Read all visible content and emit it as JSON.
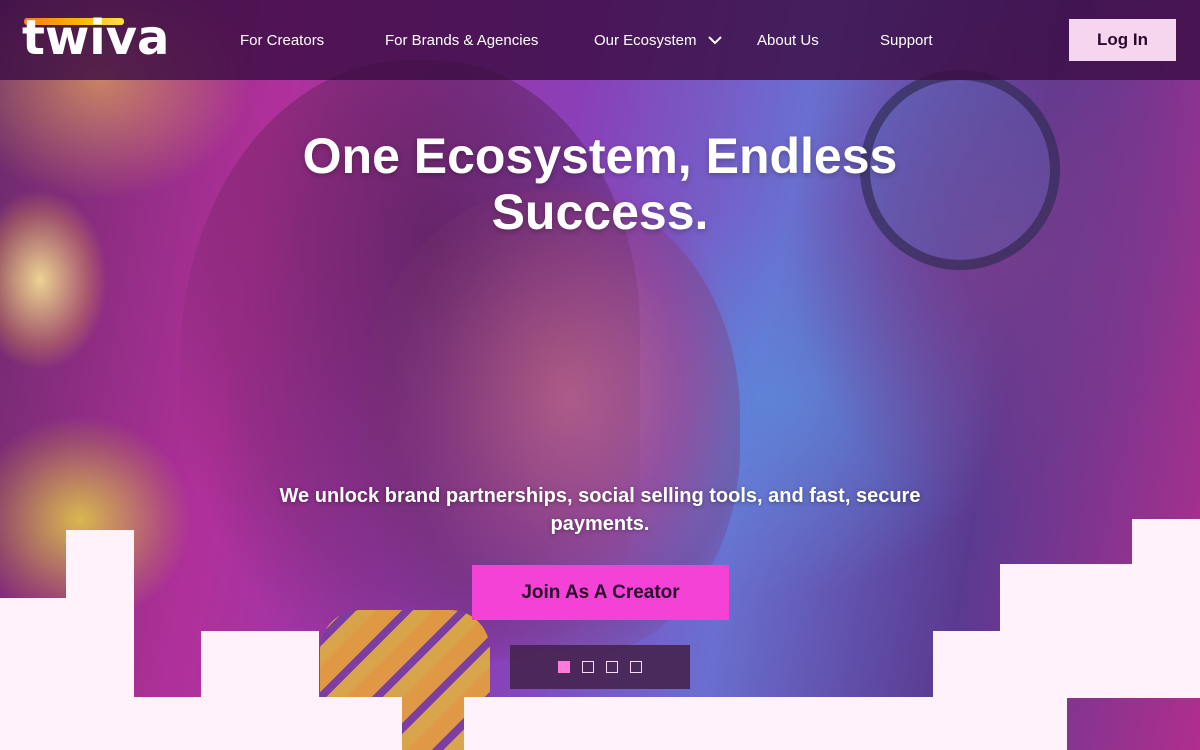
{
  "brand": {
    "name": "twiva",
    "bar_gradient": [
      "#ff7a1a",
      "#ffb400",
      "#ffe14a"
    ]
  },
  "nav": {
    "items": [
      {
        "label": "For Creators"
      },
      {
        "label": "For Brands & Agencies"
      },
      {
        "label": "Our Ecosystem",
        "has_dropdown": true,
        "icon": "chevron-down-icon"
      },
      {
        "label": "About Us"
      },
      {
        "label": "Support"
      }
    ],
    "login_label": "Log In"
  },
  "hero": {
    "headline": "One Ecosystem, Endless Success.",
    "subheadline": "We unlock brand partnerships, social selling tools, and fast, secure payments.",
    "cta_label": "Join As A Creator",
    "carousel": {
      "slide_count": 4,
      "active_index": 0
    }
  },
  "colors": {
    "header_bg": "#3c0e44",
    "cta_bg": "#f542d6",
    "login_bg": "#f4d6ee",
    "block_color": "#fff2fb",
    "dot_active": "#ff7ad9"
  }
}
